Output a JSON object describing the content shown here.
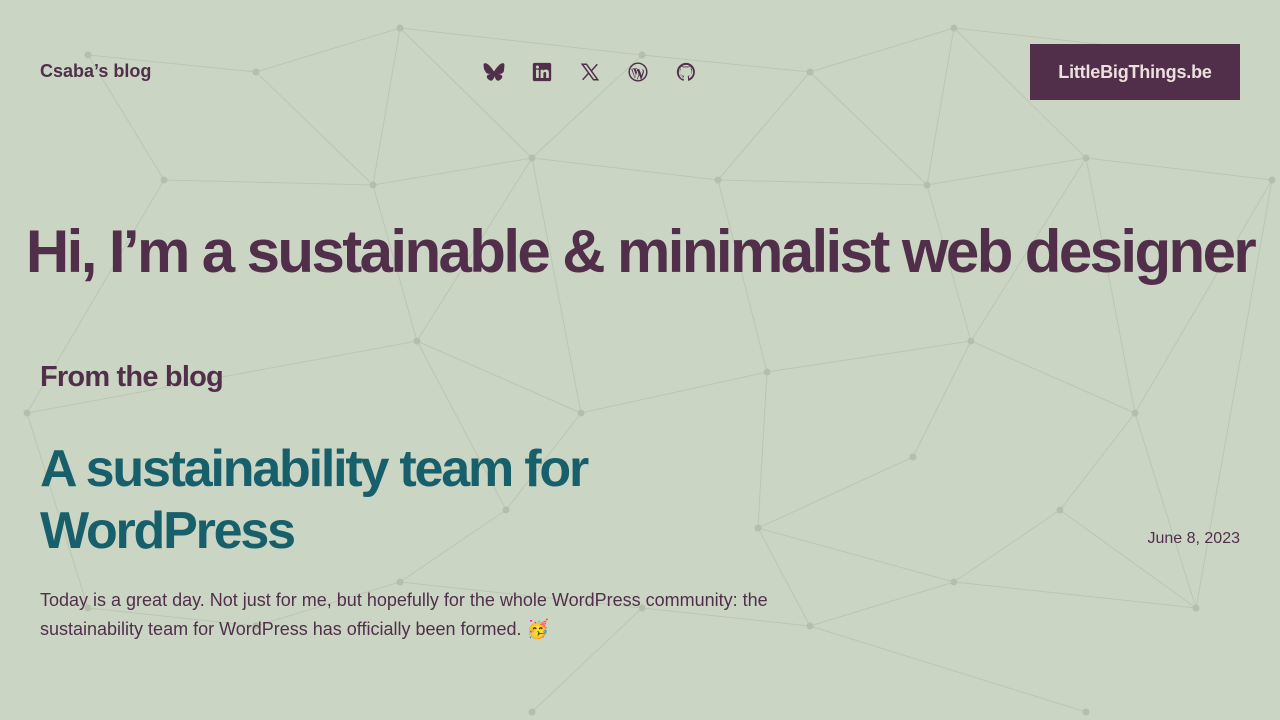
{
  "header": {
    "site_title": "Csaba’s blog",
    "social_links": [
      {
        "name": "bluesky-icon"
      },
      {
        "name": "linkedin-icon"
      },
      {
        "name": "x-icon"
      },
      {
        "name": "wordpress-icon"
      },
      {
        "name": "github-icon"
      }
    ],
    "cta_label": "LittleBigThings.be"
  },
  "hero": {
    "title": "Hi, I’m a sustainable & minimalist web designer"
  },
  "blog": {
    "section_title": "From the blog",
    "posts": [
      {
        "title": "A sustainability team for WordPress",
        "date": "June 8, 2023",
        "excerpt": "Today is a great day. Not just for me, but hopefully for the whole WordPress community: the sustainability team for WordPress has officially been formed. 🥳"
      }
    ]
  },
  "colors": {
    "background": "#cbd5c4",
    "primary": "#512f4a",
    "accent_teal": "#175f6a",
    "button_text": "#ece0de"
  }
}
